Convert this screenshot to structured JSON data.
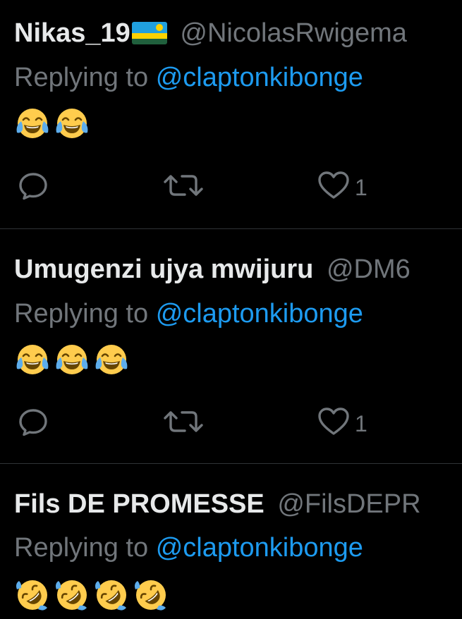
{
  "colors": {
    "background": "#000000",
    "primary_text": "#e7e9ea",
    "secondary_text": "#71767b",
    "link": "#1d9bf0",
    "divider": "#2f3336"
  },
  "tweets": [
    {
      "display_name": "Nikas_19",
      "flag": "rwanda-flag",
      "handle": "@NicolasRwigema",
      "reply_prefix": "Replying to",
      "reply_to": "@claptonkibonge",
      "emoji": "face-with-tears-of-joy",
      "emoji_count": 2,
      "icons": [
        "reply-icon",
        "retweet-icon",
        "like-icon"
      ],
      "like_count": "1"
    },
    {
      "display_name": "Umugenzi ujya mwijuru",
      "handle": "@DM6",
      "reply_prefix": "Replying to",
      "reply_to": "@claptonkibonge",
      "emoji": "face-with-tears-of-joy",
      "emoji_count": 3,
      "icons": [
        "reply-icon",
        "retweet-icon",
        "like-icon"
      ],
      "like_count": "1"
    },
    {
      "display_name": "Fils DE PROMESSE",
      "handle": "@FilsDEPR",
      "reply_prefix": "Replying to",
      "reply_to": "@claptonkibonge",
      "emoji": "rolling-on-the-floor-laughing",
      "emoji_count": 4
    }
  ]
}
